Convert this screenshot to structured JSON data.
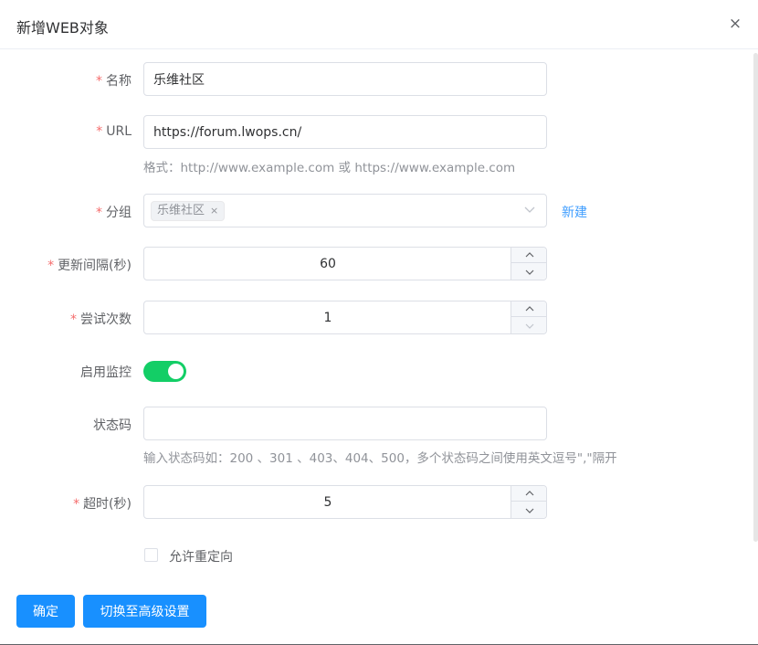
{
  "dialog": {
    "title": "新增WEB对象",
    "close_glyph": "×"
  },
  "form": {
    "required_mark": "*",
    "name": {
      "label": "名称",
      "value": "乐维社区"
    },
    "url": {
      "label": "URL",
      "value": "https://forum.lwops.cn/",
      "hint": "格式：http://www.example.com 或 https://www.example.com"
    },
    "group": {
      "label": "分组",
      "selected_tag": "乐维社区",
      "tag_remove_glyph": "×",
      "new_link": "新建"
    },
    "update_interval": {
      "label": "更新间隔(秒)",
      "value": "60"
    },
    "retries": {
      "label": "尝试次数",
      "value": "1"
    },
    "monitoring": {
      "label": "启用监控",
      "enabled": true
    },
    "status_code": {
      "label": "状态码",
      "value": "",
      "hint": "输入状态码如：200 、301 、403、404、500，多个状态码之间使用英文逗号\",\"隔开"
    },
    "timeout": {
      "label": "超时(秒)",
      "value": "5"
    },
    "allow_redirect": {
      "label": "允许重定向",
      "checked": false
    }
  },
  "footer": {
    "confirm_label": "确定",
    "advanced_label": "切换至高级设置"
  },
  "icons": {
    "close": "close-icon",
    "chevron": "chevron-down-icon",
    "stepper_up": "chevron-up-icon",
    "stepper_down": "chevron-down-icon"
  },
  "colors": {
    "primary": "#1890ff",
    "link": "#409eff",
    "required": "#f56c6c",
    "switch_on": "#13ce66"
  }
}
